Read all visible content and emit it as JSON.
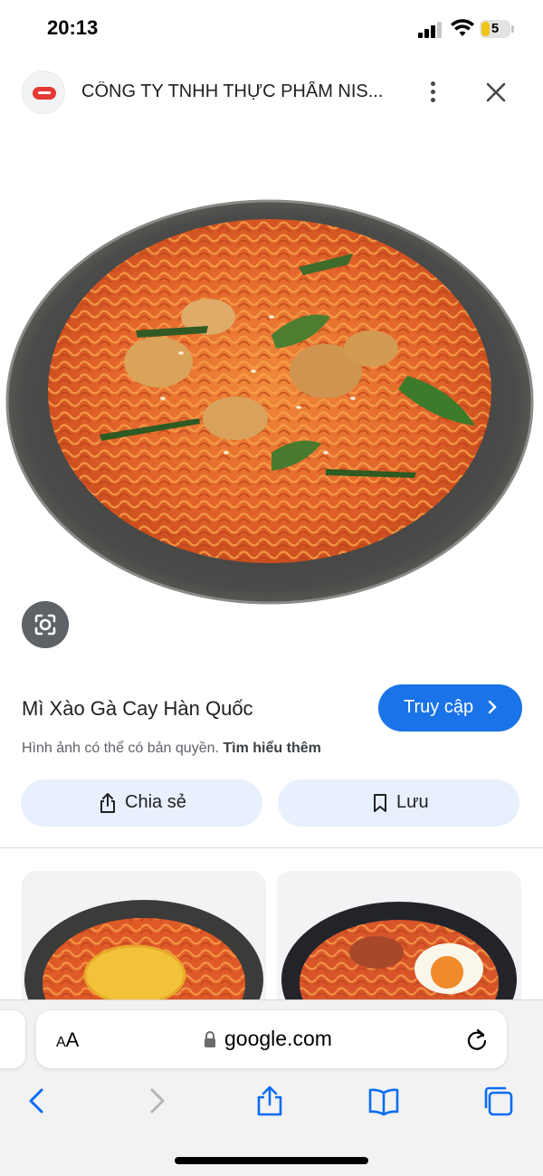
{
  "status_bar": {
    "time": "20:13",
    "battery": "5",
    "signal_bars": 3
  },
  "header": {
    "title": "CÔNG TY TNHH THỰC PHẨM NIS...",
    "more_icon": "more-vertical-icon",
    "close_icon": "close-icon"
  },
  "result": {
    "title": "Mì Xào Gà Cay Hàn Quốc",
    "visit_label": "Truy cập",
    "copyright": "Hình ảnh có thể có bản quyền.",
    "learn_more": "Tìm hiểu thêm",
    "share_label": "Chia sẻ",
    "save_label": "Lưu"
  },
  "browser": {
    "aa_label": "AA",
    "url": "google.com"
  },
  "colors": {
    "accent": "#1a73e8",
    "pill_bg": "#e8f0fe",
    "noodle": "#e2622a"
  }
}
